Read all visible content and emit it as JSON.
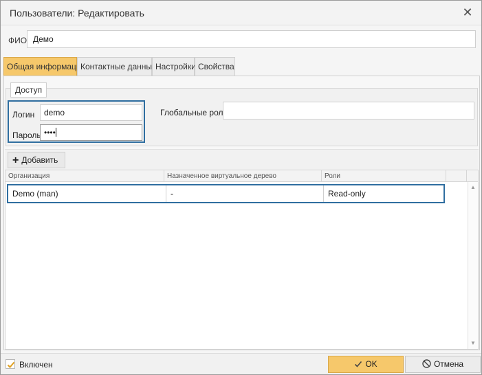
{
  "window": {
    "title": "Пользователи: Редактировать",
    "close_icon": "close-icon"
  },
  "fio": {
    "label": "ФИО",
    "value": "Демо"
  },
  "tabs": [
    {
      "label": "Общая информация",
      "active": true
    },
    {
      "label": "Контактные данные",
      "active": false
    },
    {
      "label": "Настройки",
      "active": false
    },
    {
      "label": "Свойства",
      "active": false
    }
  ],
  "access": {
    "legend": "Доступ",
    "login_label": "Логин",
    "login_value": "demo",
    "password_label": "Пароль",
    "password_value": "••••",
    "global_roles_label": "Глобальные роли",
    "global_roles_value": ""
  },
  "grid": {
    "add_label": "Добавить",
    "columns": [
      "Организация",
      "Назначенное виртуальное дерево",
      "Роли"
    ],
    "rows": [
      {
        "organization": "Demo (man)",
        "tree": "-",
        "roles": "Read-only"
      }
    ]
  },
  "footer": {
    "enabled_label": "Включен",
    "enabled_checked": true,
    "ok_label": "OK",
    "cancel_label": "Отмена"
  },
  "colors": {
    "accent": "#f6c86b",
    "focus_border": "#2f6ea0"
  }
}
